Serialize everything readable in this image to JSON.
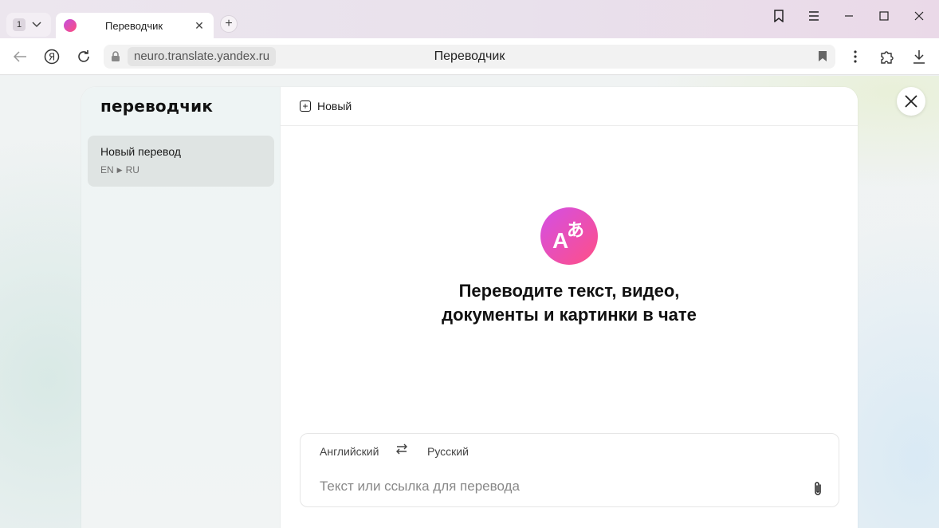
{
  "browser": {
    "tab_count": "1",
    "tab_title": "Переводчик",
    "url": "neuro.translate.yandex.ru",
    "page_title": "Переводчик"
  },
  "sidebar": {
    "brand": "переводчик",
    "history": [
      {
        "title": "Новый перевод",
        "from": "EN",
        "to": "RU"
      }
    ]
  },
  "main": {
    "new_label": "Новый",
    "hero_line1": "Переводите текст, видео,",
    "hero_line2": "документы и картинки в чате",
    "logo_letter": "A",
    "logo_glyph": "あ"
  },
  "composer": {
    "source_lang": "Английский",
    "target_lang": "Русский",
    "placeholder": "Текст или ссылка для перевода"
  },
  "colors": {
    "accent_start": "#d34fe6",
    "accent_end": "#ff4f86"
  }
}
